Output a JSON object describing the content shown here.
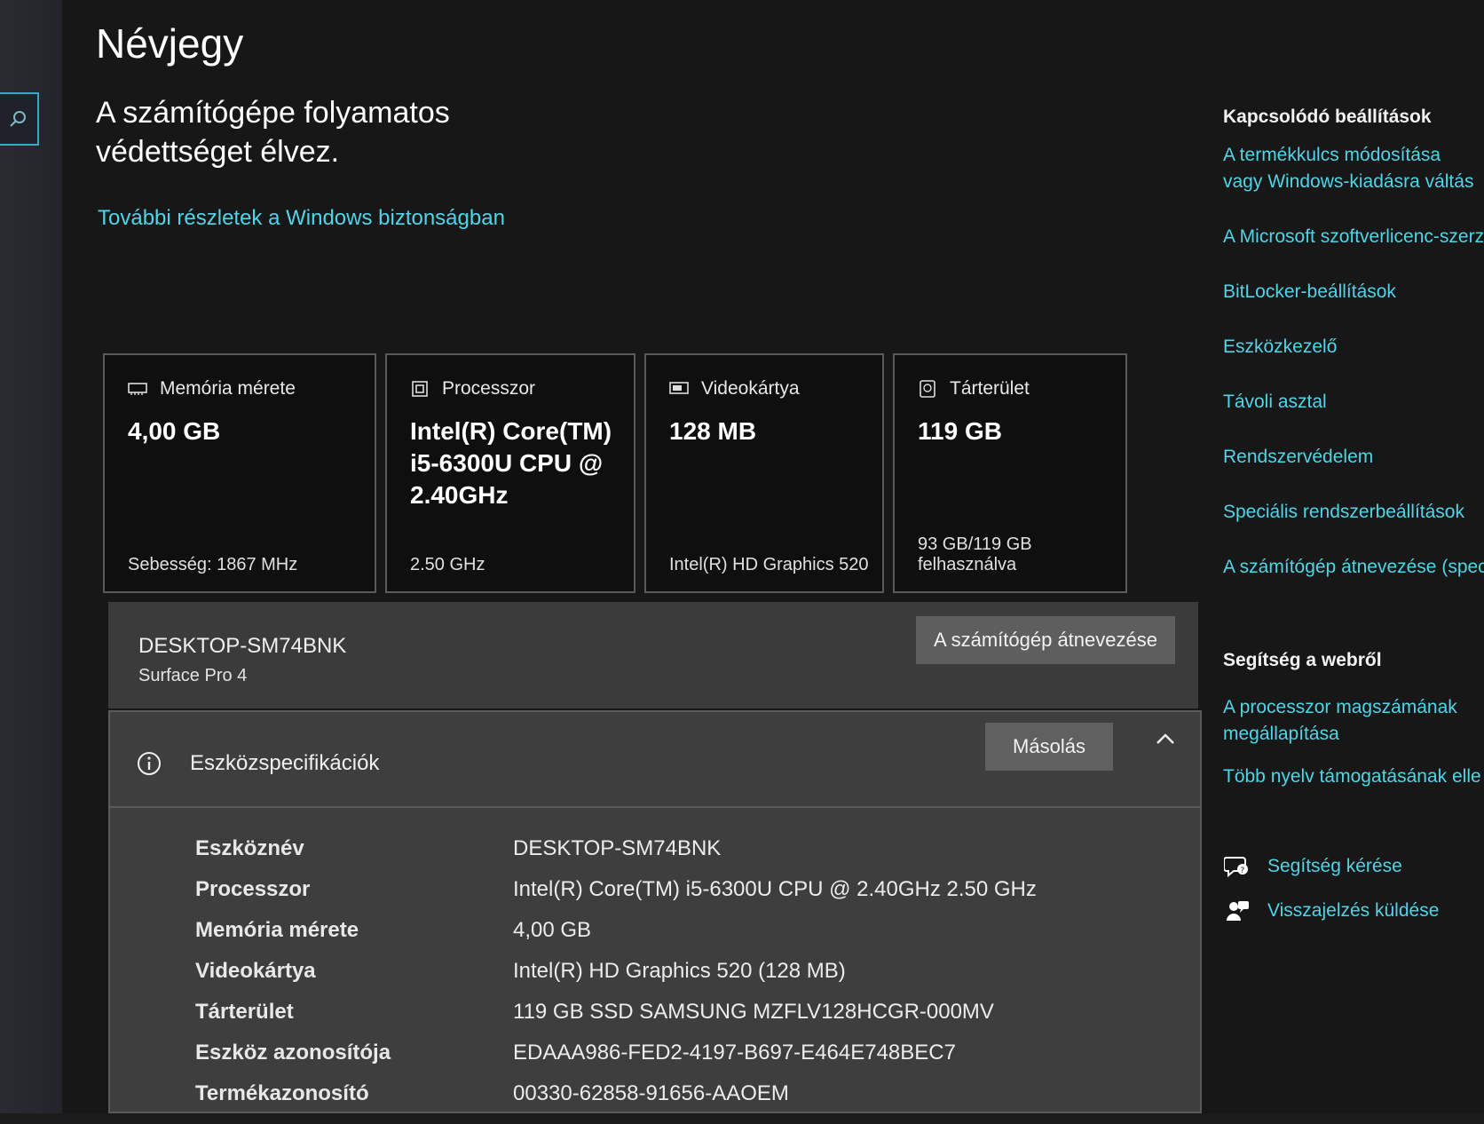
{
  "header": {
    "title": "Névjegy",
    "subtitle": "A számítógépe folyamatos védettséget élvez.",
    "security_link": "További részletek a Windows biztonságban"
  },
  "cards": [
    {
      "icon": "memory-icon",
      "label": "Memória mérete",
      "value": "4,00 GB",
      "foot": "Sebesség: 1867 MHz"
    },
    {
      "icon": "processor-icon",
      "label": "Processzor",
      "value": "Intel(R) Core(TM) i5-6300U CPU @ 2.40GHz",
      "foot": "2.50 GHz"
    },
    {
      "icon": "display-adapter-icon",
      "label": "Videokártya",
      "value": "128 MB",
      "foot": "Intel(R) HD Graphics 520"
    },
    {
      "icon": "storage-icon",
      "label": "Tárterület",
      "value": "119 GB",
      "foot": "93 GB/119 GB felhasználva"
    }
  ],
  "device": {
    "name": "DESKTOP-SM74BNK",
    "model": "Surface Pro 4",
    "rename_button": "A számítógép átnevezése"
  },
  "specs": {
    "title": "Eszközspecifikációk",
    "copy_button": "Másolás",
    "rows": [
      {
        "label": "Eszköznév",
        "value": "DESKTOP-SM74BNK"
      },
      {
        "label": "Processzor",
        "value": "Intel(R) Core(TM) i5-6300U CPU @ 2.40GHz   2.50 GHz"
      },
      {
        "label": "Memória mérete",
        "value": "4,00 GB"
      },
      {
        "label": "Videokártya",
        "value": "Intel(R) HD Graphics 520 (128 MB)"
      },
      {
        "label": "Tárterület",
        "value": "119 GB SSD SAMSUNG MZFLV128HCGR-000MV"
      },
      {
        "label": "Eszköz azonosítója",
        "value": "EDAAA986-FED2-4197-B697-E464E748BEC7"
      },
      {
        "label": "Termékazonosító",
        "value": "00330-62858-91656-AAOEM"
      }
    ]
  },
  "related": {
    "heading": "Kapcsolódó beállítások",
    "links": [
      "A termékkulcs módosítása vagy Windows-kiadásra váltás",
      "A Microsoft szoftverlicenc-szerz",
      "BitLocker-beállítások",
      "Eszközkezelő",
      "Távoli asztal",
      "Rendszervédelem",
      "Speciális rendszerbeállítások",
      "A számítógép átnevezése (spec"
    ]
  },
  "web_help": {
    "heading": "Segítség a webről",
    "links": [
      "A processzor magszámának megállapítása",
      "Több nyelv támogatásának elle"
    ]
  },
  "actions": {
    "get_help": "Segítség kérése",
    "feedback": "Visszajelzés küldése"
  },
  "colors": {
    "accent_link": "#4fd4e8",
    "background": "#171717",
    "panel": "#3e3e3e"
  }
}
